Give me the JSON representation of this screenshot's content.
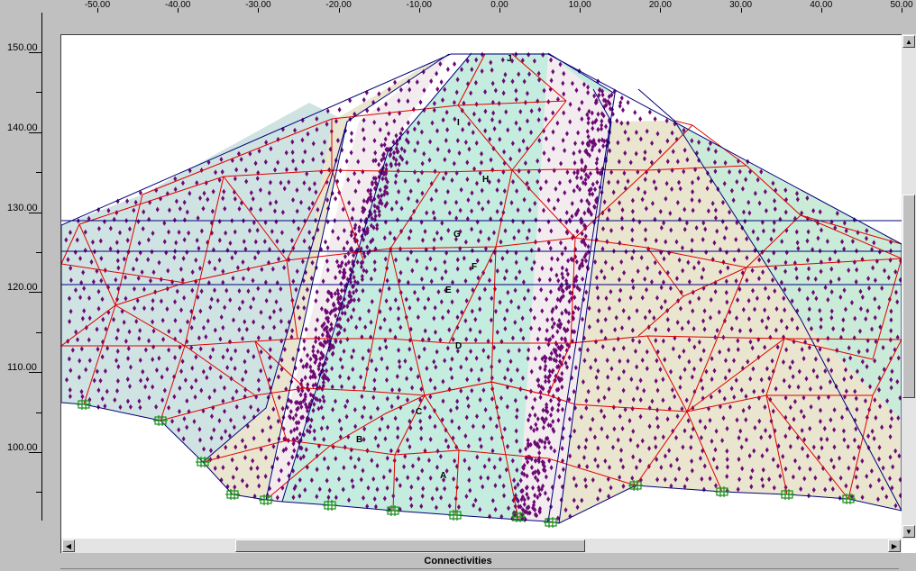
{
  "x_axis": {
    "ticks": [
      "-50.00",
      "-40.00",
      "-30.00",
      "-20.00",
      "-10.00",
      "0.00",
      "10.00",
      "20.00",
      "30.00",
      "40.00",
      "50.00"
    ]
  },
  "y_axis": {
    "ticks": [
      "150.00",
      "140.00",
      "130.00",
      "120.00",
      "110.00",
      "100.00"
    ]
  },
  "region_labels": [
    "A",
    "B",
    "C",
    "D",
    "E",
    "F",
    "G",
    "H",
    "I",
    "J"
  ],
  "status": {
    "label": "Connectivities"
  },
  "colors": {
    "background": "#c0c0c0",
    "region_blue": "#cfe3e3",
    "region_cyan": "#c4ecdf",
    "region_tan": "#e9e5cf",
    "region_pink": "#f3ecef",
    "region_green": "#c9ebd7",
    "element_edges": "#e00000",
    "region_boundaries": "#00007a",
    "nodes": "#6c0a74",
    "supports": "#178d17"
  },
  "icons": {
    "scroll_up": "triangle-up-icon",
    "scroll_down": "triangle-down-icon",
    "scroll_left": "triangle-left-icon",
    "scroll_right": "triangle-right-icon",
    "support": "fixed-support-icon"
  }
}
